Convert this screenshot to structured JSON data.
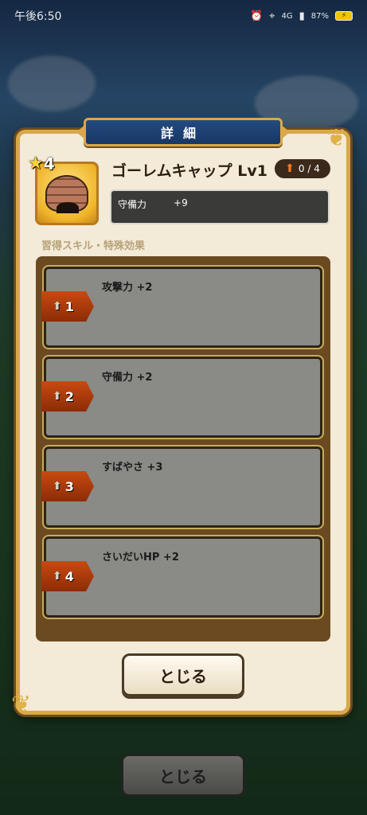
{
  "status_bar": {
    "time": "午後6:50",
    "network": "4G",
    "battery": "87%"
  },
  "dialog": {
    "title": "詳細",
    "item": {
      "name": "ゴーレムキャップ Lv1",
      "rarity_stars": "4",
      "upgrade_count": "0 / 4",
      "stat_name": "守備力",
      "stat_value": "+9"
    },
    "section_label": "習得スキル・特殊効果",
    "skills": [
      {
        "level": "1",
        "text": "攻撃力 +2"
      },
      {
        "level": "2",
        "text": "守備力 +2"
      },
      {
        "level": "3",
        "text": "すばやさ +3"
      },
      {
        "level": "4",
        "text": "さいだいHP +2"
      }
    ],
    "close_label": "とじる"
  },
  "background": {
    "close_label": "とじる"
  }
}
